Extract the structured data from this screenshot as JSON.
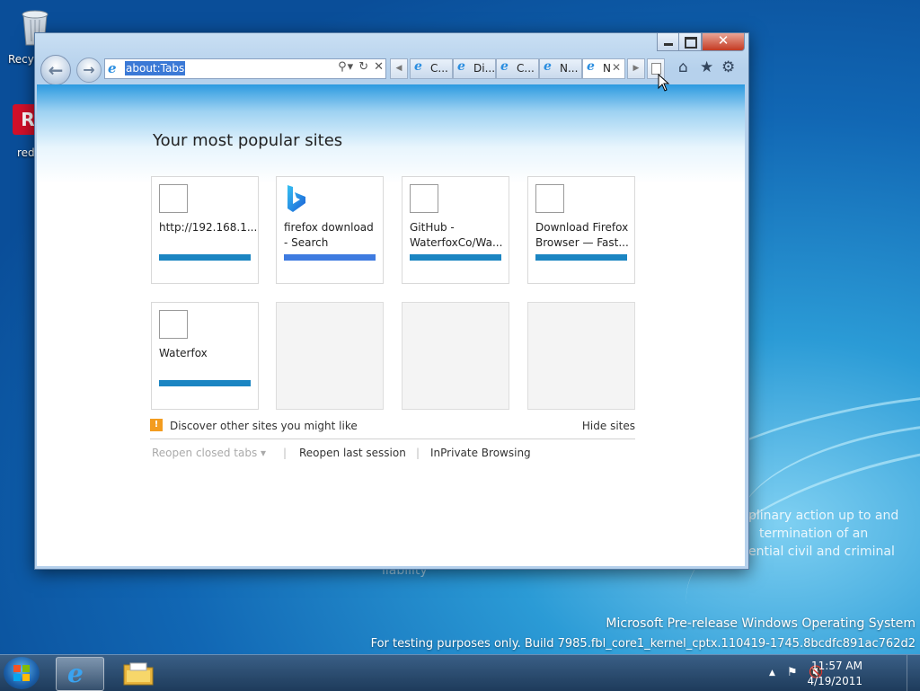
{
  "desktop": {
    "icons": [
      {
        "label": "Recyc"
      },
      {
        "label": "redl"
      }
    ],
    "bg_text": [
      "plinary action up to and",
      "termination of an",
      "ential civil and criminal",
      "liability"
    ],
    "watermark": {
      "line1": "Microsoft Pre-release Windows Operating System",
      "line2": "For testing purposes only. Build 7985.fbl_core1_kernel_cptx.110419-1745.8bcdfc891ac762d2"
    }
  },
  "browser": {
    "address": "about:Tabs",
    "close_glyph": "✕",
    "nav": {
      "back": "←",
      "forward": "→"
    },
    "addr_buttons": {
      "search": "⚲",
      "dropdown": "▾",
      "refresh": "↻",
      "stop": "✕"
    },
    "tabs": [
      {
        "label": "C...",
        "active": false
      },
      {
        "label": "Di...",
        "active": false
      },
      {
        "label": "C...",
        "active": false
      },
      {
        "label": "N...",
        "active": false
      },
      {
        "label": "N",
        "active": true
      }
    ],
    "tab_close": "✕",
    "toolbar": {
      "home": "⌂",
      "favorites": "★",
      "tools": "⚙"
    },
    "tabs_scroll": {
      "left": "◀",
      "right": "▶"
    }
  },
  "page": {
    "heading": "Your most popular sites",
    "tiles": [
      {
        "title": "http://192.168.1...",
        "has_bar": true
      },
      {
        "title": "firefox download - Search",
        "has_bar": true
      },
      {
        "title": "GitHub - WaterfoxCo/Wa...",
        "has_bar": true
      },
      {
        "title": "Download Firefox Browser — Fast...",
        "has_bar": true
      },
      {
        "title": "Waterfox",
        "has_bar": true
      }
    ],
    "discover": "Discover other sites you might like",
    "hide_sites": "Hide sites",
    "reopen_closed": "Reopen closed tabs ▾",
    "reopen_last": "Reopen last session",
    "inprivate": "InPrivate Browsing",
    "separator": "|"
  },
  "taskbar": {
    "time": "11:57 AM",
    "date": "4/19/2011",
    "tray": {
      "arrow": "▲",
      "flag": "⚑",
      "volume": "🔇"
    }
  }
}
